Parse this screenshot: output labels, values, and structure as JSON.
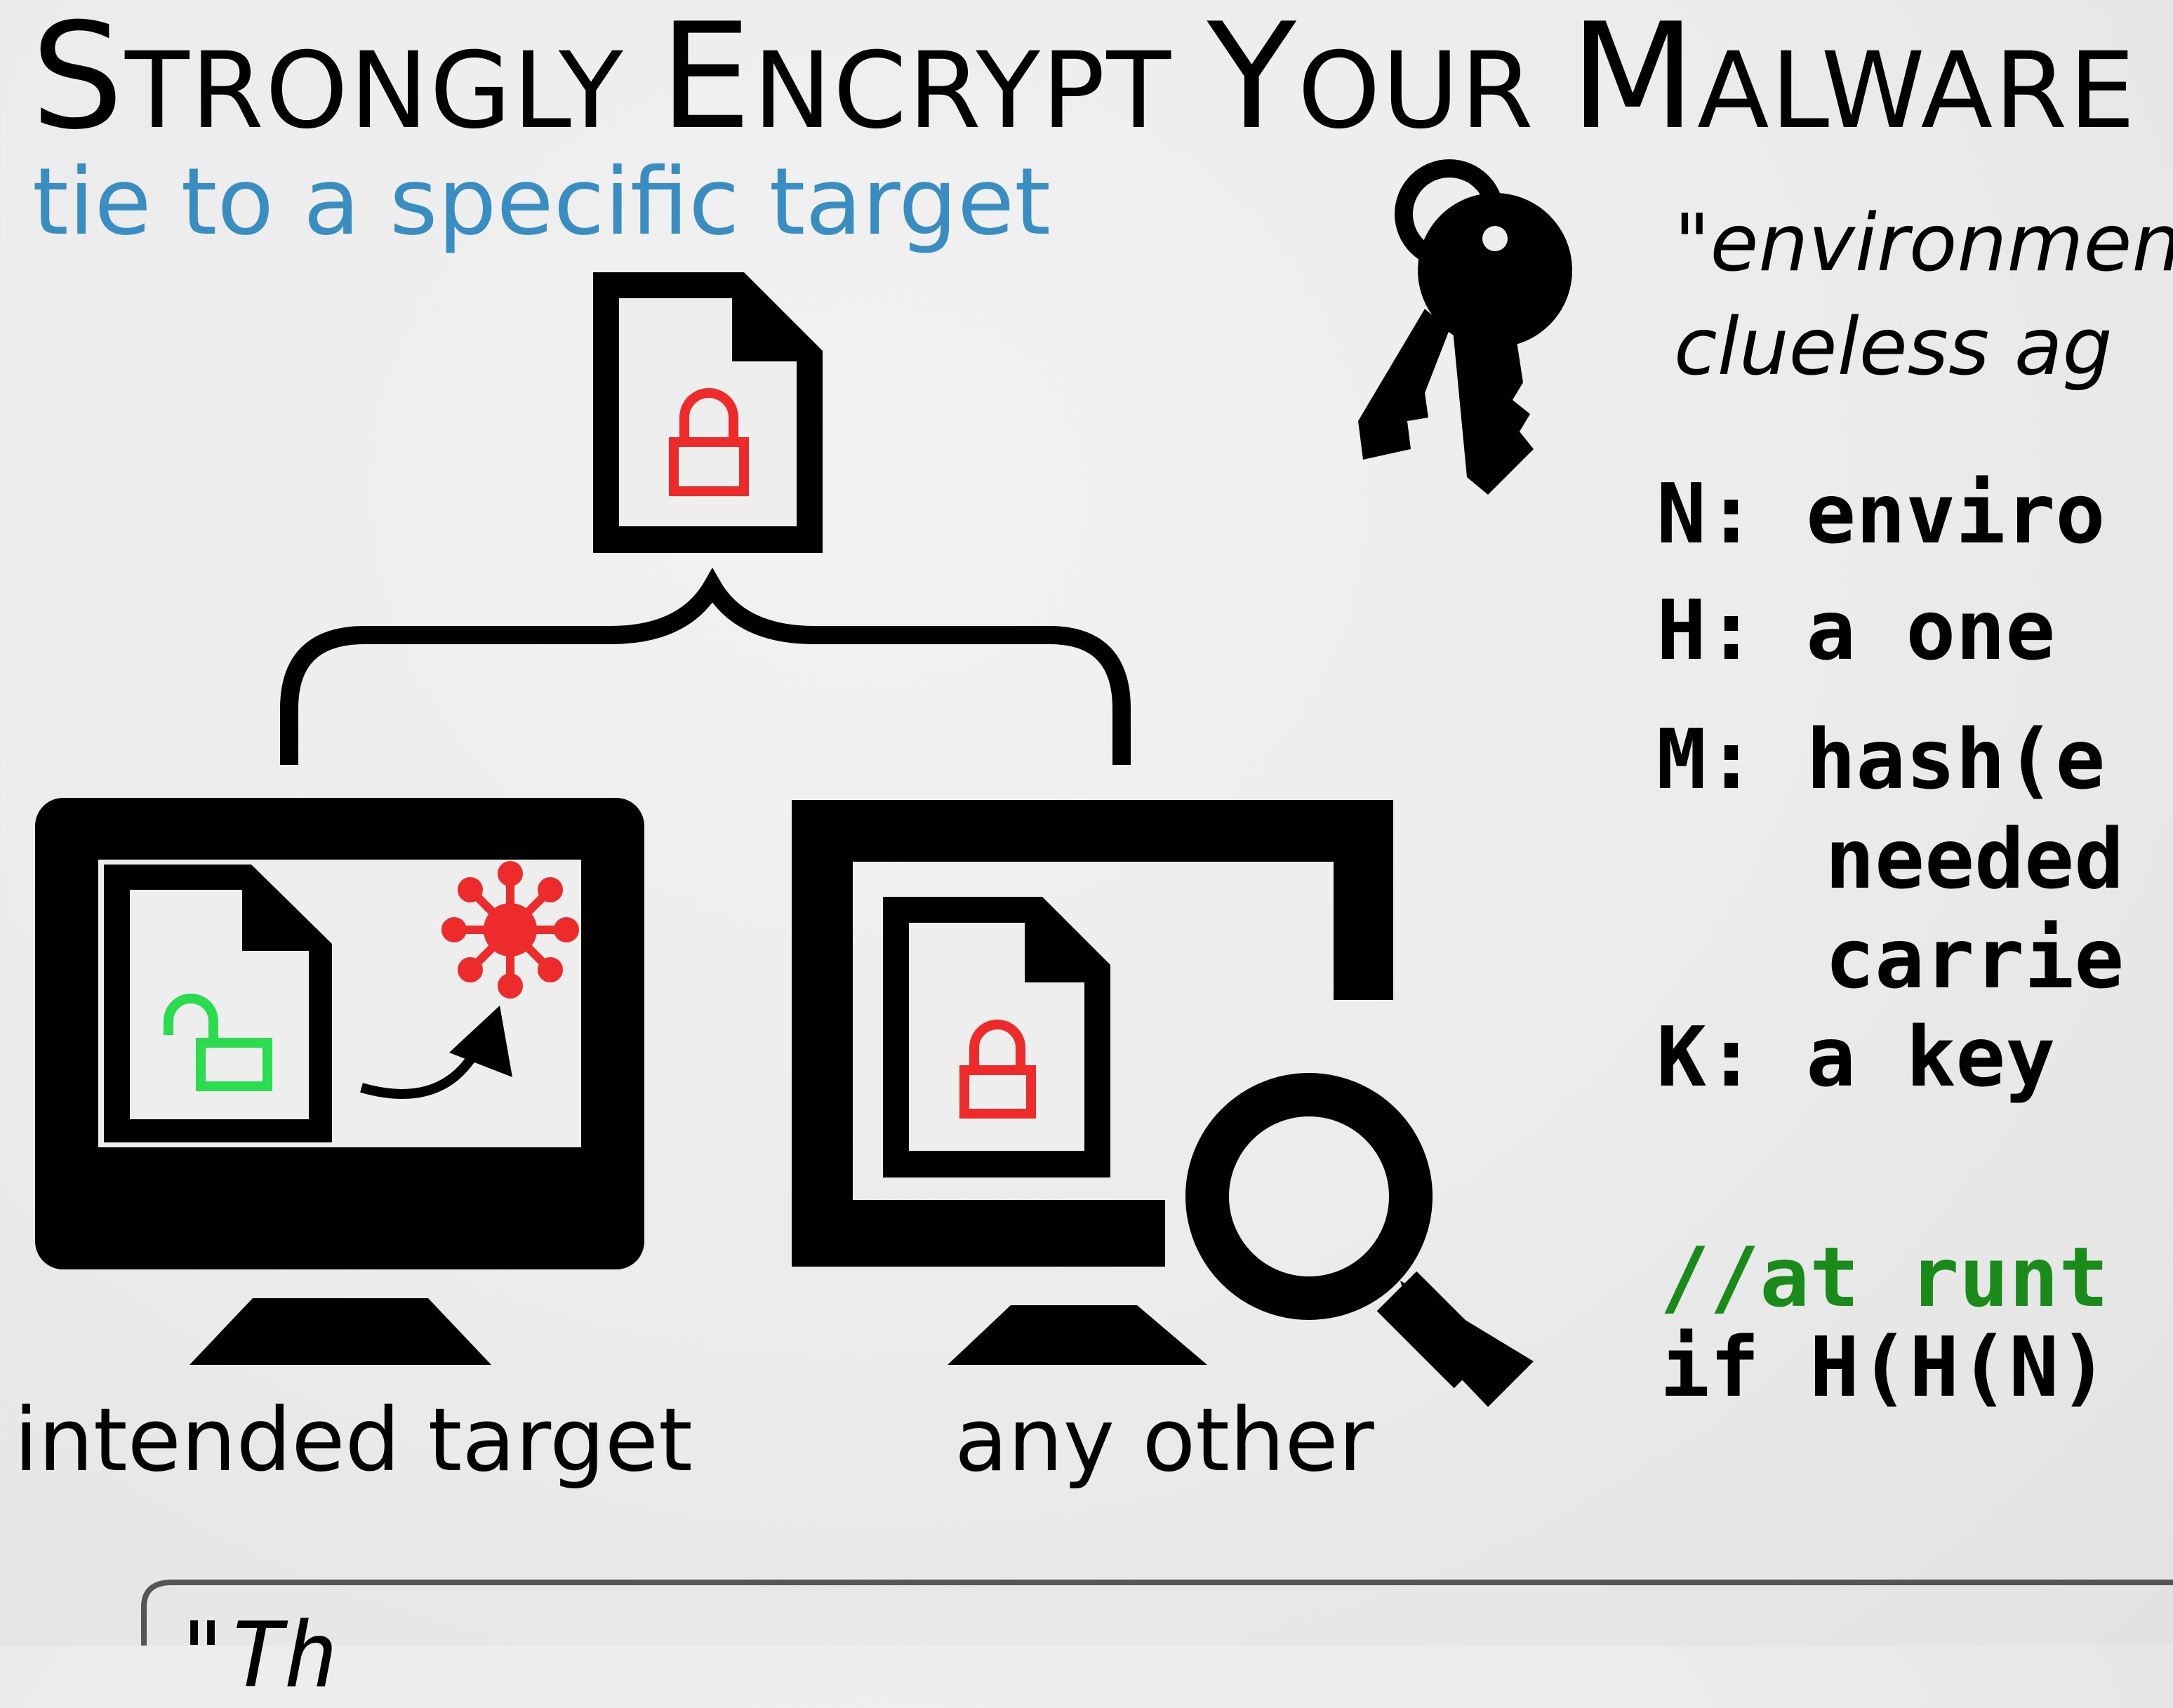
{
  "slide": {
    "title_parts": [
      "S",
      "TRONGLY ",
      "E",
      "NCRYPT ",
      "Y",
      "OUR ",
      "M",
      "ALWARE"
    ],
    "subtitle": "tie to a specific target",
    "quote_lines": [
      "\"environmen",
      "clueless ag"
    ],
    "definitions": [
      {
        "key": "N:",
        "text": "enviro"
      },
      {
        "key": "H:",
        "text": "a one "
      },
      {
        "key": "M:",
        "text": "hash(e"
      },
      {
        "key": "",
        "text": "needed"
      },
      {
        "key": "",
        "text": "carrie"
      },
      {
        "key": "K:",
        "text": "a key"
      }
    ],
    "code_comment": "//at runt",
    "code_line": "if H(H(N)",
    "labels": {
      "intended": "intended target",
      "other": "any other"
    },
    "bottom_quote": "\"Th                          "
  },
  "icons": {
    "encrypted_file": "file-locked-icon",
    "decrypted_file": "file-unlocked-icon",
    "malware": "virus-icon",
    "keys": "keys-icon",
    "magnifier": "magnifying-glass-icon"
  },
  "colors": {
    "subtitle": "#3a8dc1",
    "lock_red": "#ee2b2b",
    "lock_green": "#2bdc4f",
    "code_green": "#1a8a1a"
  }
}
